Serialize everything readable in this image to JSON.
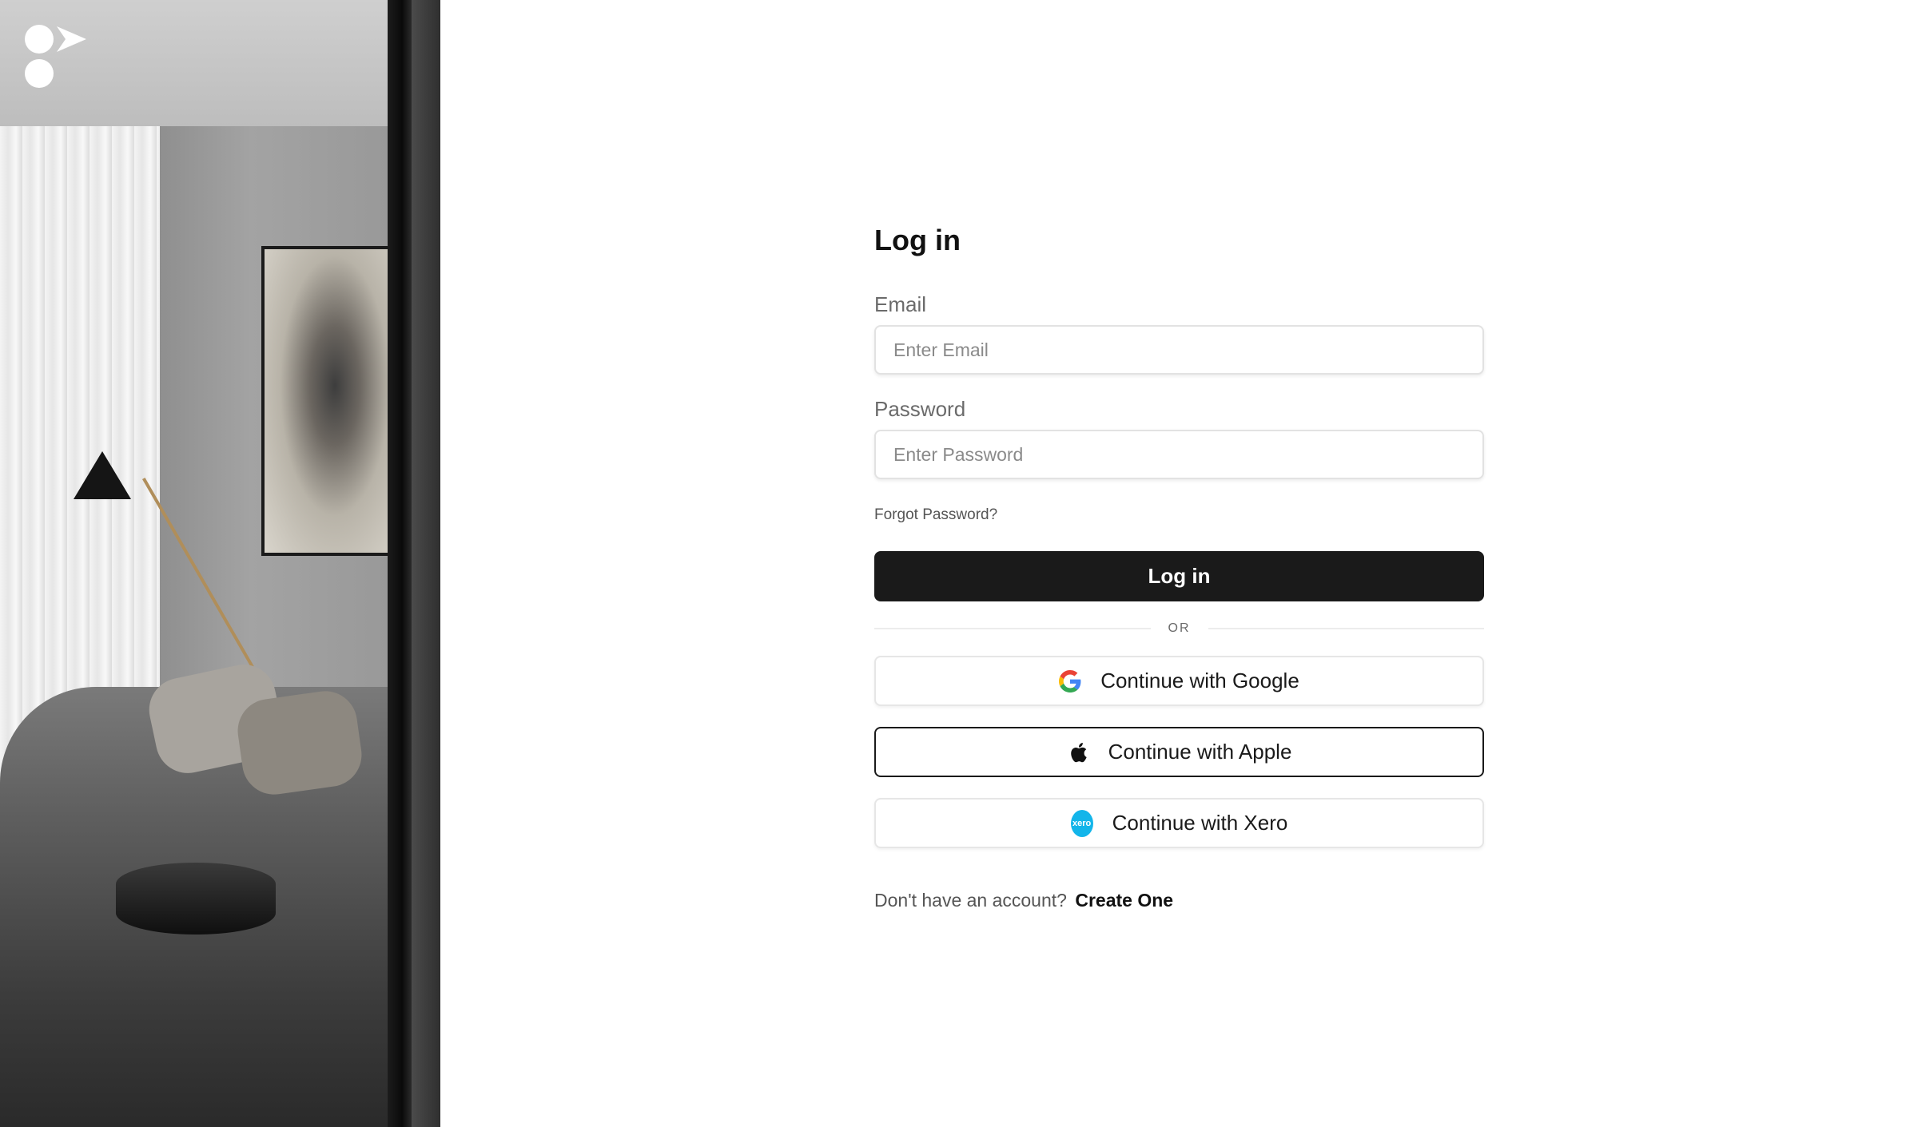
{
  "brand": {
    "logo_icon": "brand-logo-icon",
    "background_image": "living-room-interior-photo"
  },
  "login": {
    "title": "Log in",
    "email": {
      "label": "Email",
      "placeholder": "Enter Email",
      "value": ""
    },
    "password": {
      "label": "Password",
      "placeholder": "Enter Password",
      "value": ""
    },
    "forgot_password": "Forgot Password?",
    "submit_label": "Log in",
    "divider_label": "OR",
    "social": {
      "google_label": "Continue with Google",
      "apple_label": "Continue with Apple",
      "xero_label": "Continue with Xero",
      "xero_badge_text": "xero"
    },
    "signup_prompt": "Don't have an account?",
    "signup_link": "Create One"
  },
  "colors": {
    "primary_button": "#1a1a1a",
    "xero_blue": "#13b5ea",
    "text_muted": "#6b6b6b"
  }
}
